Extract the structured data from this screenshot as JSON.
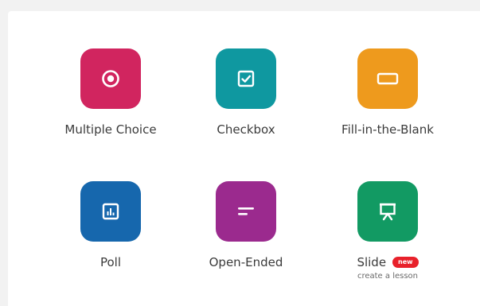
{
  "colors": {
    "multiple_choice": "#d1255f",
    "checkbox": "#0f98a0",
    "fill_blank": "#ee9a1d",
    "poll": "#1667ad",
    "open_ended": "#9b2a8e",
    "slide": "#129a63",
    "new_badge": "#e8212b"
  },
  "question_types": {
    "multiple_choice": {
      "label": "Multiple Choice",
      "icon": "radio-button-icon"
    },
    "checkbox": {
      "label": "Checkbox",
      "icon": "checkbox-icon"
    },
    "fill_blank": {
      "label": "Fill-in-the-Blank",
      "icon": "blank-field-icon"
    },
    "poll": {
      "label": "Poll",
      "icon": "bar-chart-icon"
    },
    "open_ended": {
      "label": "Open-Ended",
      "icon": "text-lines-icon"
    },
    "slide": {
      "label": "Slide",
      "icon": "presentation-icon",
      "badge": "new",
      "sublabel": "create a lesson"
    }
  }
}
